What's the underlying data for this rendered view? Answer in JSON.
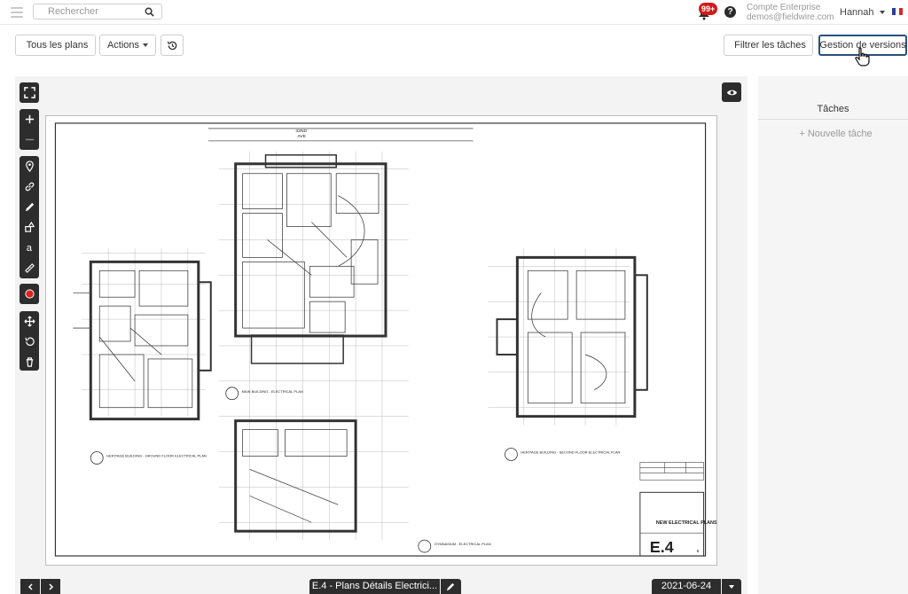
{
  "topbar": {
    "search_placeholder": "Rechercher",
    "notifications_badge": "99+",
    "help_label": "?",
    "account_line1": "Compte Enterprise",
    "account_line2": "demos@fieldwire.com",
    "user_name": "Hannah",
    "language_flag": "french-flag-icon"
  },
  "toolbar": {
    "all_plans_label": "Tous les plans",
    "actions_label": "Actions",
    "history_icon": "history-icon",
    "filter_tasks_label": "Filtrer les tâches",
    "version_management_label": "Gestion de versions"
  },
  "drawing": {
    "top_street": "32ND",
    "top_street2": "AVE",
    "caption1": "HERITAGE BUILDING - GROUND FLOOR ELECTRICAL PLAN",
    "caption2": "MAIN BUILDING - ELECTRICAL PLAN",
    "caption3": "HERITAGE BUILDING - SECOND FLOOR ELECTRICAL PLAN",
    "caption4": "GYMNASIUM - ELECTRICAL PLAN",
    "title_block_name": "NEW ELECTRICAL PLANS",
    "sheet_number": "E.4",
    "sheet_index": "6"
  },
  "right_panel": {
    "title": "Tâches",
    "new_task_label": "+ Nouvelle tâche"
  },
  "bottom": {
    "plan_name": "E.4 - Plans Détails Electrici...",
    "version_date": "2021-06-24"
  },
  "colors": {
    "dark_control": "#2d2d2d",
    "active_border": "#2c4f7c",
    "badge_red": "#d11a1a",
    "record_red": "#e02020"
  }
}
